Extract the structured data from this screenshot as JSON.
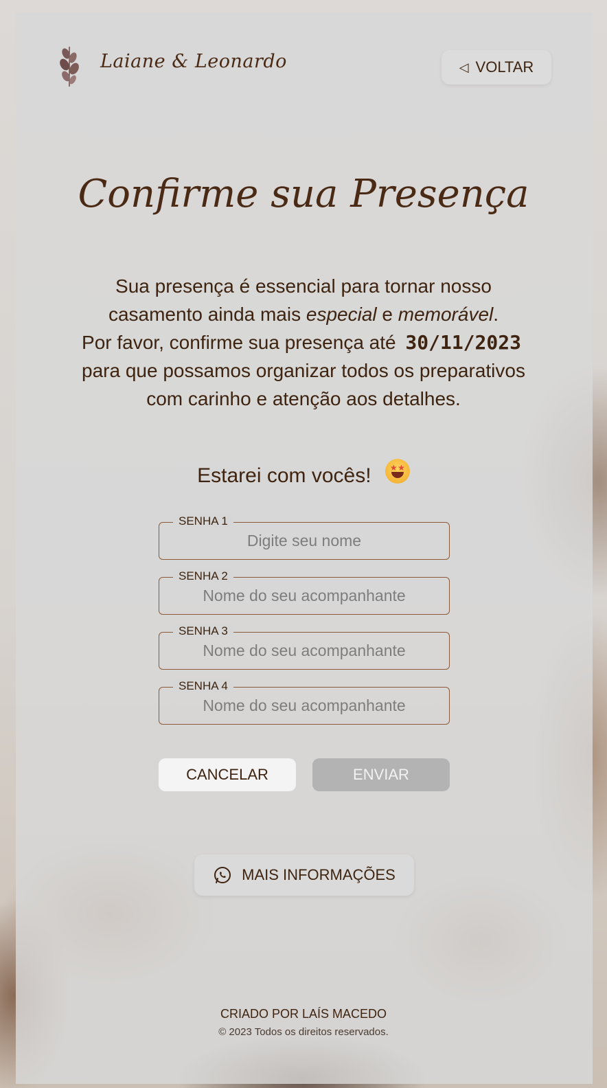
{
  "header": {
    "names": "Laiane & Leonardo",
    "back_label": "VOLTAR"
  },
  "main": {
    "title": "Confirme sua Presença",
    "intro_part1": "Sua presença é essencial para tornar nosso casamento ainda mais ",
    "intro_em1": "especial",
    "intro_and": " e ",
    "intro_em2": "memorável",
    "intro_period": ".",
    "intro_part2": "Por favor, confirme sua presença até",
    "deadline": "30/11/2023",
    "intro_part3": "para que possamos organizar todos os preparativos com carinho e atenção aos detalhes.",
    "attend_label": "Estarei com vocês!"
  },
  "form": {
    "fields": [
      {
        "label": "SENHA 1",
        "placeholder": "Digite seu nome",
        "value": ""
      },
      {
        "label": "SENHA 2",
        "placeholder": "Nome do seu acompanhante",
        "value": ""
      },
      {
        "label": "SENHA 3",
        "placeholder": "Nome do seu acompanhante",
        "value": ""
      },
      {
        "label": "SENHA 4",
        "placeholder": "Nome do seu acompanhante",
        "value": ""
      }
    ],
    "cancel_label": "CANCELAR",
    "send_label": "ENVIAR"
  },
  "info_button": {
    "label": "MAIS INFORMAÇÕES",
    "icon": "whatsapp-icon"
  },
  "footer": {
    "credit": "CRIADO POR LAÍS MACEDO",
    "copyright": "© 2023   Todos os direitos reservados."
  },
  "colors": {
    "text_brown": "#4a2a14",
    "field_border": "#8a5a3a",
    "send_disabled": "#b3b3b3"
  }
}
